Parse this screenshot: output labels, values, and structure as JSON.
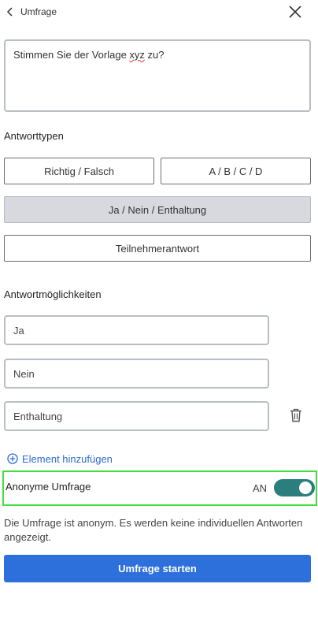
{
  "header": {
    "back_label": "Umfrage"
  },
  "question": {
    "text_before": "Stimmen Sie der Vorlage ",
    "text_flagged": "xyz",
    "text_after": " zu?"
  },
  "answer_types": {
    "title": "Antworttypen",
    "options": [
      {
        "label": "Richtig / Falsch",
        "selected": false
      },
      {
        "label": "A / B / C / D",
        "selected": false
      },
      {
        "label": "Ja / Nein / Enthaltung",
        "selected": true
      },
      {
        "label": "Teilnehmerantwort",
        "selected": false
      }
    ]
  },
  "answer_options": {
    "title": "Antwortmöglichkeiten",
    "items": [
      "Ja",
      "Nein",
      "Enthaltung"
    ],
    "add_label": "Element hinzufügen"
  },
  "anonymous": {
    "label": "Anonyme Umfrage",
    "state_label": "AN",
    "enabled": true,
    "description": "Die Umfrage ist anonym. Es werden keine individuellen Antworten angezeigt."
  },
  "start_button": {
    "label": "Umfrage starten"
  },
  "colors": {
    "accent": "#2e70db",
    "toggle_on": "#2a7e7e",
    "selected_bg": "#d7d9de",
    "highlight_border": "#3fe03a"
  },
  "icons": [
    "chevron-left-icon",
    "close-icon",
    "trash-icon",
    "plus-circle-icon"
  ]
}
